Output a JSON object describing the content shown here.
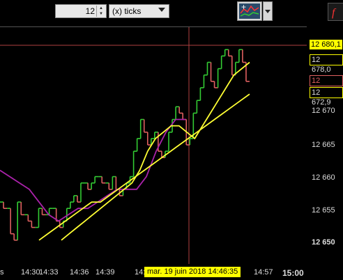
{
  "toolbar": {
    "ticks_value": "12",
    "ticks_unit": "(x) ticks",
    "indicator_icon": "chart-indicator-icon",
    "formula_icon": "fx-icon"
  },
  "colors": {
    "up": "#33cc33",
    "down": "#e06060",
    "ma_fast": "#ffff33",
    "ma_slow": "#ffff33",
    "ma_purple": "#aa22aa",
    "crosshair": "#b04040"
  },
  "price_axis": {
    "labels": [
      "12 670",
      "12 665",
      "12 660",
      "12 655",
      "12 650"
    ],
    "tags": [
      {
        "text": "12 680,1",
        "style": "yellow"
      },
      {
        "text": "12 678,0",
        "style": "yellow"
      },
      {
        "text": "12 674,7",
        "style": "red"
      },
      {
        "text": "12 672,9",
        "style": "yellow"
      }
    ]
  },
  "time_axis": {
    "labels": [
      "14:30",
      "14:33",
      "14:36",
      "14:39",
      "14:",
      "14:57",
      "15:00"
    ],
    "cursor_date": "mar. 19 juin 2018 14:46:35",
    "left_edge": "s"
  },
  "chart_data": {
    "type": "line",
    "ylim": [
      12648,
      12682
    ],
    "price_steps": [
      12656,
      12655,
      12655,
      12651,
      12650,
      12656,
      12654,
      12654,
      12653,
      12652,
      12652,
      12655,
      12654,
      12654,
      12655,
      12655,
      12653,
      12652,
      12653,
      12655,
      12656,
      12657,
      12656,
      12659,
      12659,
      12658,
      12659,
      12660,
      12660,
      12659,
      12659,
      12658,
      12660,
      12658,
      12657,
      12658,
      12659,
      12660,
      12664,
      12666,
      12669,
      12667,
      12665,
      12666,
      12667,
      12664,
      12663,
      12664,
      12667,
      12669,
      12671,
      12670,
      12669,
      12665,
      12666,
      12670,
      12672,
      12674,
      12676,
      12678,
      12675,
      12674,
      12677,
      12679,
      12680,
      12679,
      12676,
      12678,
      12680,
      12678,
      12675
    ],
    "ma_fast": [
      12650,
      12651,
      12652,
      12653,
      12654,
      12655,
      12656,
      12657,
      12658,
      12659,
      12661,
      12664,
      12666,
      12667,
      12668,
      12668,
      12667,
      12666,
      12668,
      12670,
      12672,
      12674,
      12676,
      12677,
      12678
    ],
    "ma_slow": [
      12650,
      12651,
      12652,
      12653,
      12654,
      12655,
      12656,
      12656,
      12657,
      12658,
      12659,
      12660,
      12661,
      12662,
      12663,
      12664,
      12665,
      12666,
      12667,
      12668,
      12669,
      12670,
      12671,
      12672,
      12673
    ],
    "ma_purple": [
      12661,
      12660,
      12659,
      12658,
      12656,
      12654,
      12653,
      12654,
      12655,
      12655,
      12656,
      12657,
      12658,
      12658,
      12658,
      12660,
      12664,
      12667,
      12669,
      12669
    ]
  }
}
